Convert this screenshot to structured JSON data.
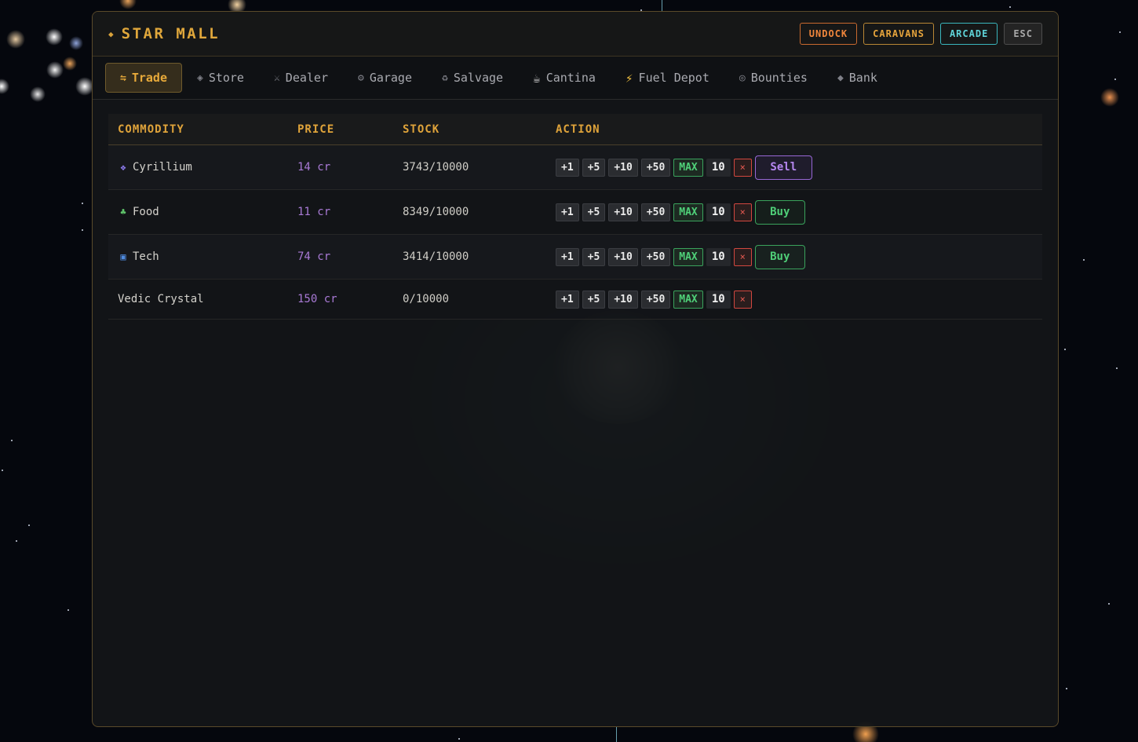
{
  "window": {
    "title": "STAR MALL",
    "header_buttons": {
      "undock": "UNDOCK",
      "caravans": "CARAVANS",
      "arcade": "ARCADE",
      "esc": "ESC"
    }
  },
  "tabs": [
    {
      "label": "Trade",
      "icon": "⇋",
      "active": true
    },
    {
      "label": "Store",
      "icon": "◈"
    },
    {
      "label": "Dealer",
      "icon": "⚔"
    },
    {
      "label": "Garage",
      "icon": "⚙"
    },
    {
      "label": "Salvage",
      "icon": "♻"
    },
    {
      "label": "Cantina",
      "icon": "☕"
    },
    {
      "label": "Fuel Depot",
      "icon": "⚡"
    },
    {
      "label": "Bounties",
      "icon": "◎"
    },
    {
      "label": "Bank",
      "icon": "◆"
    }
  ],
  "table": {
    "headers": {
      "commodity": "COMMODITY",
      "price": "PRICE",
      "stock": "STOCK",
      "action": "ACTION"
    },
    "quantity_buttons": {
      "p1": "+1",
      "p5": "+5",
      "p10": "+10",
      "p50": "+50",
      "max": "MAX",
      "clear": "×"
    },
    "rows": [
      {
        "name": "Cyrillium",
        "icon": "crystal-icon",
        "icon_glyph": "❖",
        "icon_color": "#8e7cf0",
        "price": "14 cr",
        "stock": "3743/10000",
        "quantity": "10",
        "trade_label": "Sell"
      },
      {
        "name": "Food",
        "icon": "plant-icon",
        "icon_glyph": "♣",
        "icon_color": "#5fc46a",
        "price": "11 cr",
        "stock": "8349/10000",
        "quantity": "10",
        "trade_label": "Buy"
      },
      {
        "name": "Tech",
        "icon": "chip-icon",
        "icon_glyph": "▣",
        "icon_color": "#4f8be0",
        "price": "74 cr",
        "stock": "3414/10000",
        "quantity": "10",
        "trade_label": "Buy"
      },
      {
        "name": "Vedic Crystal",
        "icon": "",
        "price": "150 cr",
        "stock": "0/10000",
        "quantity": "10",
        "trade_label": ""
      }
    ]
  },
  "colors": {
    "accent": "#e0a73b",
    "price": "#a97ad6",
    "sell": "#b687f0",
    "buy": "#4fcf78",
    "danger": "#e0584f",
    "arcade": "#5fd3d8",
    "undock": "#f0863c"
  }
}
